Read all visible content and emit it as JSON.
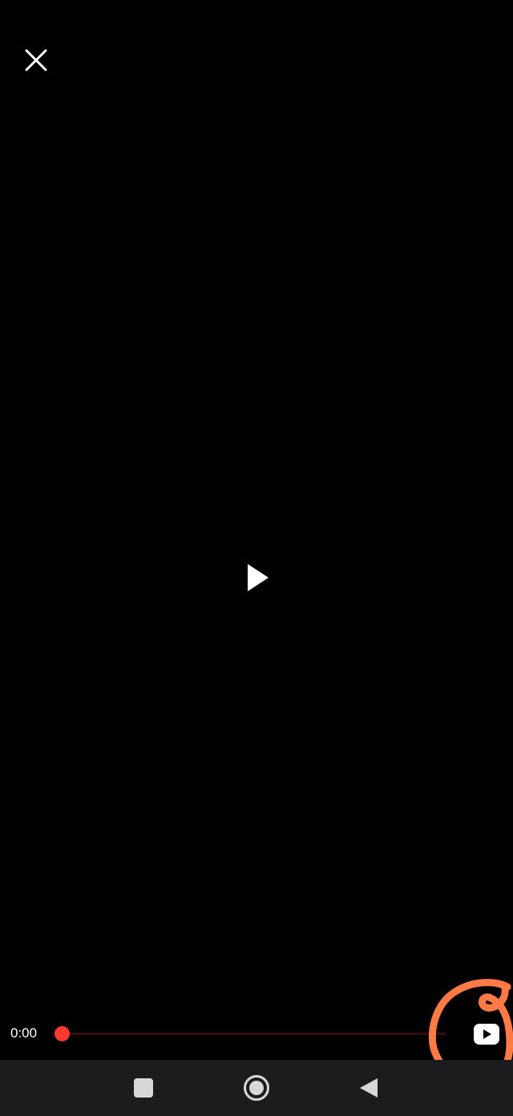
{
  "player": {
    "current_time": "0:00",
    "progress": 0,
    "accent_color": "#ff3b30",
    "background_color": "#000000",
    "icons": {
      "close": "close-icon",
      "play": "play-icon",
      "youtube": "youtube-icon"
    }
  },
  "annotation": {
    "color": "#ff7a45",
    "shape": "hand-drawn circle around youtube button"
  },
  "navigation_bar": {
    "background_color": "#1c1c1e",
    "buttons": [
      "recent-apps-icon",
      "home-icon",
      "back-icon"
    ]
  }
}
